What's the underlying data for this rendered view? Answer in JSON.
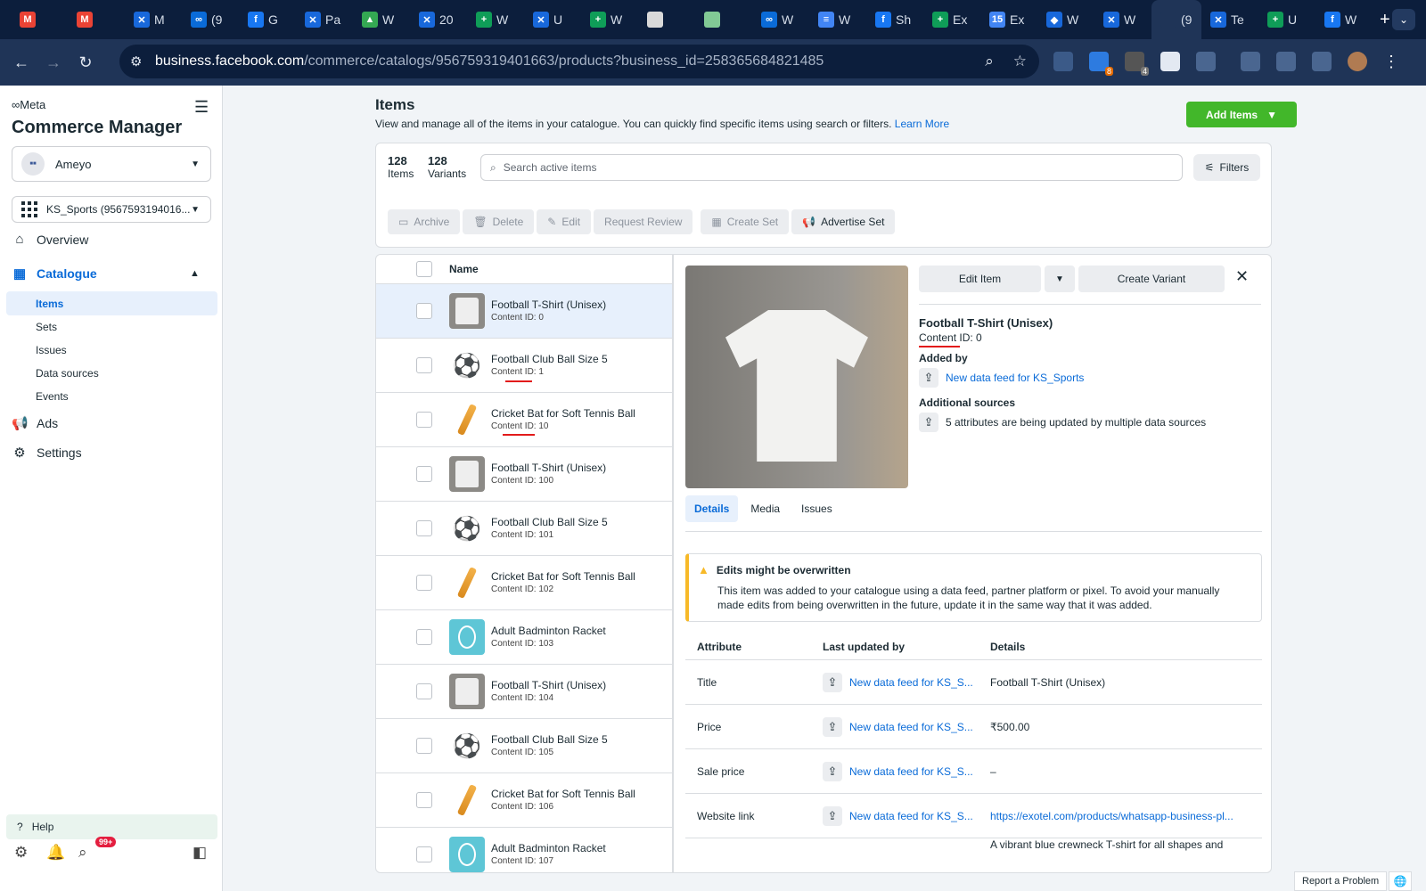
{
  "browser": {
    "tabs": [
      {
        "icon": "M",
        "color": "#ea4335",
        "label": ""
      },
      {
        "icon": "M",
        "color": "#ea4335",
        "label": ""
      },
      {
        "icon": "✕",
        "color": "#1868db",
        "label": "M"
      },
      {
        "icon": "∞",
        "color": "#0a6bd8",
        "label": "(9"
      },
      {
        "icon": "f",
        "color": "#1877f2",
        "label": "G"
      },
      {
        "icon": "✕",
        "color": "#1868db",
        "label": "Pa"
      },
      {
        "icon": "▲",
        "color": "#34a853",
        "label": "W"
      },
      {
        "icon": "✕",
        "color": "#1868db",
        "label": "20"
      },
      {
        "icon": "+",
        "color": "#0f9d58",
        "label": "W"
      },
      {
        "icon": "✕",
        "color": "#1868db",
        "label": "U"
      },
      {
        "icon": "+",
        "color": "#0f9d58",
        "label": "W"
      },
      {
        "icon": "",
        "color": "#d9d9d9",
        "label": ""
      },
      {
        "icon": "",
        "color": "#81c995",
        "label": ""
      },
      {
        "icon": "∞",
        "color": "#0a6bd8",
        "label": "W"
      },
      {
        "icon": "≡",
        "color": "#4285f4",
        "label": "W"
      },
      {
        "icon": "f",
        "color": "#1877f2",
        "label": "Sh"
      },
      {
        "icon": "+",
        "color": "#0f9d58",
        "label": "Ex"
      },
      {
        "icon": "15",
        "color": "#4285f4",
        "label": "Ex"
      },
      {
        "icon": "◆",
        "color": "#1868db",
        "label": "W"
      },
      {
        "icon": "✕",
        "color": "#1868db",
        "label": "W"
      },
      {
        "icon": "",
        "color": "#1f3457",
        "label": "(9",
        "active": true
      },
      {
        "icon": "✕",
        "color": "#1868db",
        "label": "Te"
      },
      {
        "icon": "+",
        "color": "#0f9d58",
        "label": "U"
      },
      {
        "icon": "f",
        "color": "#1877f2",
        "label": "W"
      }
    ],
    "url_host": "business.facebook.com",
    "url_path": "/commerce/catalogs/956759319401663/products?business_id=258365684821485",
    "ext_badges": [
      "8",
      "4"
    ]
  },
  "sidebar": {
    "meta": "Meta",
    "title": "Commerce Manager",
    "business": "Ameyo",
    "catalog": "KS_Sports (9567593194016...",
    "nav": {
      "overview": "Overview",
      "catalogue": "Catalogue",
      "ads": "Ads",
      "settings": "Settings"
    },
    "sub": [
      "Items",
      "Sets",
      "Issues",
      "Data sources",
      "Events"
    ],
    "help": "Help",
    "notif_badge": "99+"
  },
  "page": {
    "title": "Items",
    "desc": "View and manage all of the items in your catalogue. You can quickly find specific items using search or filters.",
    "learn": "Learn More",
    "add_items": "Add Items",
    "items_count": "128",
    "items_label": "Items",
    "variants_count": "128",
    "variants_label": "Variants",
    "search_placeholder": "Search active items",
    "filters": "Filters",
    "toolbar": [
      "Archive",
      "Delete",
      "Edit",
      "Request Review",
      "Create Set",
      "Advertise Set"
    ]
  },
  "list": {
    "header": "Name",
    "rows": [
      {
        "name": "Football T-Shirt (Unisex)",
        "id": "Content ID: 0",
        "kind": "shirt"
      },
      {
        "name": "Football Club Ball Size 5",
        "id": "Content ID: 1",
        "kind": "ball"
      },
      {
        "name": "Cricket Bat for Soft Tennis Ball",
        "id": "Content ID: 10",
        "kind": "bat"
      },
      {
        "name": "Football T-Shirt (Unisex)",
        "id": "Content ID: 100",
        "kind": "shirt"
      },
      {
        "name": "Football Club Ball Size 5",
        "id": "Content ID: 101",
        "kind": "ball"
      },
      {
        "name": "Cricket Bat for Soft Tennis Ball",
        "id": "Content ID: 102",
        "kind": "bat"
      },
      {
        "name": "Adult Badminton Racket",
        "id": "Content ID: 103",
        "kind": "racket"
      },
      {
        "name": "Football T-Shirt (Unisex)",
        "id": "Content ID: 104",
        "kind": "shirt"
      },
      {
        "name": "Football Club Ball Size 5",
        "id": "Content ID: 105",
        "kind": "ball"
      },
      {
        "name": "Cricket Bat for Soft Tennis Ball",
        "id": "Content ID: 106",
        "kind": "bat"
      },
      {
        "name": "Adult Badminton Racket",
        "id": "Content ID: 107",
        "kind": "racket"
      }
    ]
  },
  "detail": {
    "edit_item": "Edit Item",
    "create_variant": "Create Variant",
    "name": "Football T-Shirt (Unisex)",
    "content_id": "Content ID: 0",
    "added_by_label": "Added by",
    "added_by": "New data feed for KS_Sports",
    "addl_label": "Additional sources",
    "addl_text": "5 attributes are being updated by multiple data sources",
    "tabs": [
      "Details",
      "Media",
      "Issues"
    ],
    "warn_title": "Edits might be overwritten",
    "warn_text": "This item was added to your catalogue using a data feed, partner platform or pixel. To avoid your manually made edits from being overwritten in the future, update it in the same way that it was added.",
    "table_head": [
      "Attribute",
      "Last updated by",
      "Details"
    ],
    "table_rows": [
      {
        "attr": "Title",
        "by": "New data feed for KS_S...",
        "val": "Football T-Shirt (Unisex)",
        "link": false
      },
      {
        "attr": "Price",
        "by": "New data feed for KS_S...",
        "val": "₹500.00",
        "link": false
      },
      {
        "attr": "Sale price",
        "by": "New data feed for KS_S...",
        "val": "–",
        "link": false
      },
      {
        "attr": "Website link",
        "by": "New data feed for KS_S...",
        "val": "https://exotel.com/products/whatsapp-business-pl...",
        "link": true
      },
      {
        "attr": "",
        "by": "",
        "val": "A vibrant blue crewneck T-shirt for all shapes and",
        "link": false
      }
    ]
  },
  "footer": {
    "report": "Report a Problem"
  }
}
